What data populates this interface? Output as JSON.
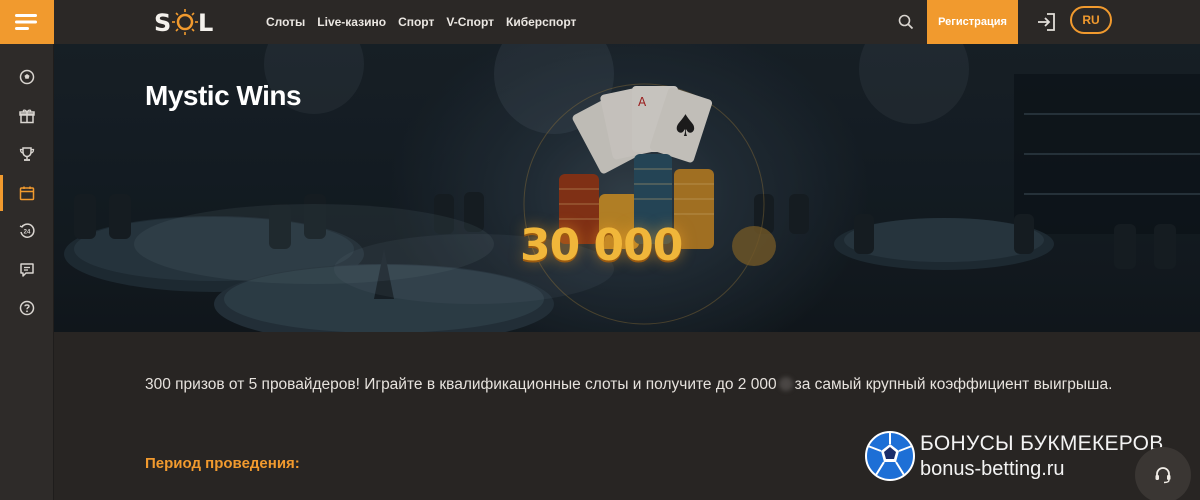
{
  "header": {
    "logo_text": "SOL",
    "nav": [
      "Слоты",
      "Live-казино",
      "Спорт",
      "V-Спорт",
      "Киберспорт"
    ],
    "register_label": "Регистрация",
    "language": "RU",
    "accent_color": "#f19a2e"
  },
  "sidebar": {
    "items": [
      {
        "icon": "soccer-ball-icon"
      },
      {
        "icon": "gift-icon"
      },
      {
        "icon": "trophy-icon"
      },
      {
        "icon": "calendar-icon",
        "active": true
      },
      {
        "icon": "clock-24-icon"
      },
      {
        "icon": "chat-icon"
      },
      {
        "icon": "help-icon"
      }
    ]
  },
  "hero": {
    "title": "Mystic Wins",
    "amount": "30 000"
  },
  "content": {
    "description_part1": "300 призов от 5 провайдеров! Играйте в квалификационные слоты и получите до 2 000",
    "description_part2": "за самый крупный коэффициент выигрыша.",
    "period_label": "Период проведения:"
  },
  "watermark": {
    "title": "БОНУСЫ БУКМЕКЕРОВ",
    "url": "bonus-betting.ru"
  }
}
